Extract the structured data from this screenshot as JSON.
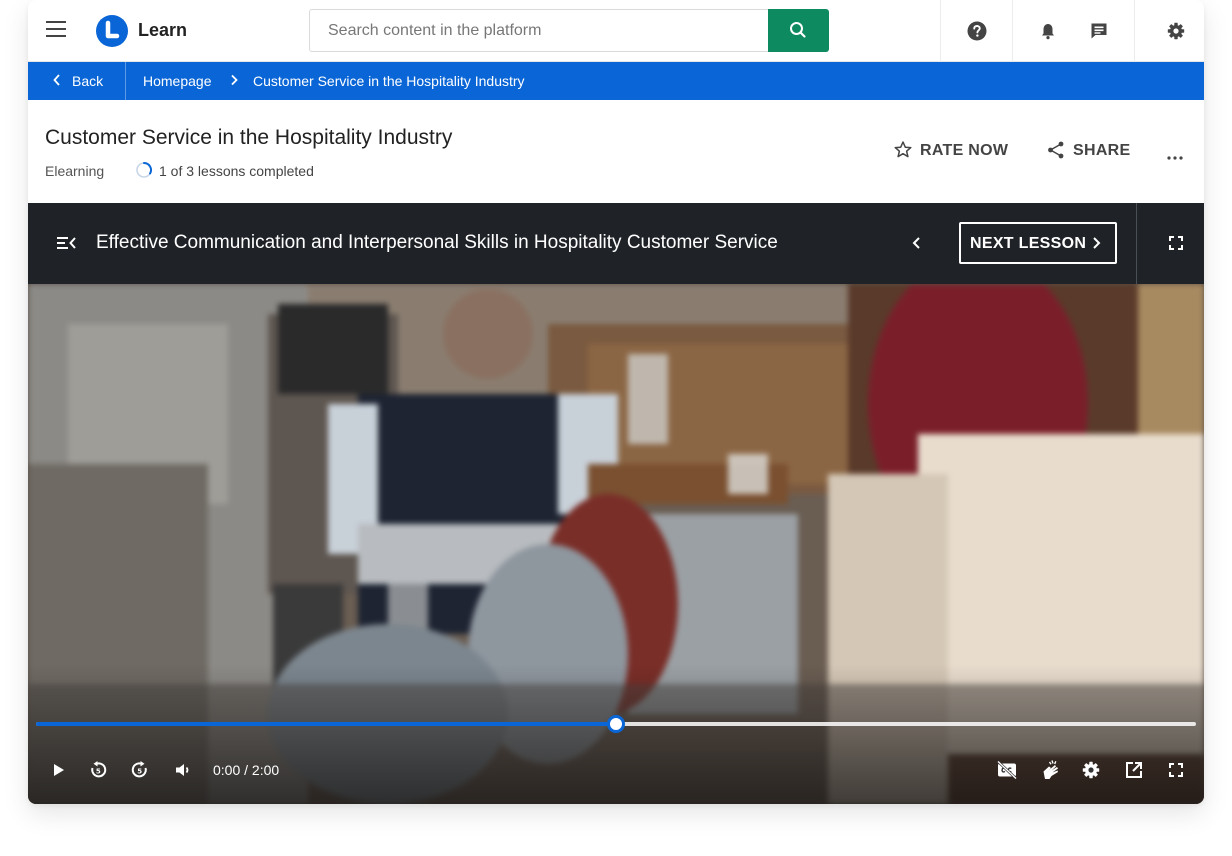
{
  "app": {
    "name": "Learn",
    "brand_color": "#0a66d6"
  },
  "search": {
    "placeholder": "Search content in the platform"
  },
  "topbar_icons": [
    "menu-icon",
    "search-icon",
    "help-icon",
    "bell-icon",
    "chat-icon",
    "gear-icon"
  ],
  "breadcrumb": {
    "back": "Back",
    "items": [
      "Homepage",
      "Customer Service in the Hospitality Industry"
    ]
  },
  "course": {
    "title": "Customer Service in the Hospitality Industry",
    "type": "Elearning",
    "progress_text": "1 of 3 lessons completed",
    "lessons_completed": 1,
    "lessons_total": 3,
    "rate_label": "RATE NOW",
    "share_label": "SHARE"
  },
  "lesson": {
    "title": "Effective Communication and Interpersonal Skills in Hospitality Customer Service",
    "next_label": "NEXT LESSON"
  },
  "player": {
    "time": "0:00 / 2:00",
    "played_fraction": 0.5,
    "accent_color": "#0a66d6",
    "control_icons": [
      "play-icon",
      "rewind-icon",
      "forward-icon",
      "volume-icon",
      "captions-off-icon",
      "sign-language-icon",
      "settings-icon",
      "popout-icon",
      "fullscreen-icon"
    ]
  }
}
